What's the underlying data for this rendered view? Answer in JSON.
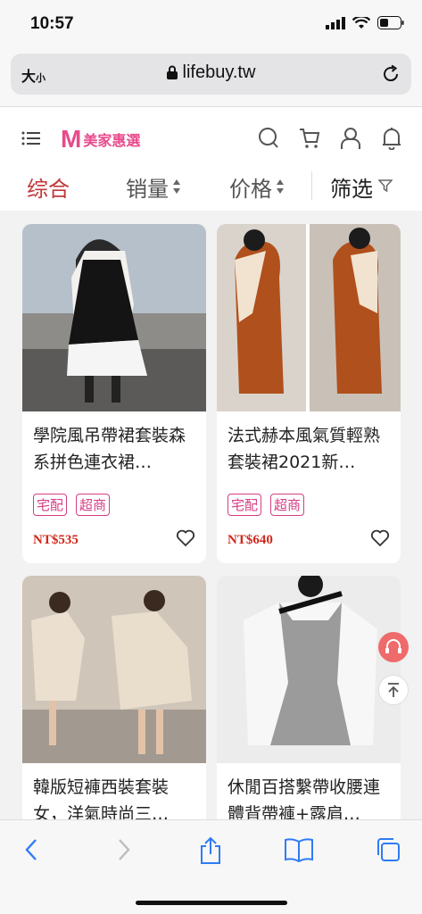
{
  "status": {
    "time": "10:57"
  },
  "browser": {
    "text_size": "大",
    "text_size_small": "小",
    "url": "lifebuy.tw"
  },
  "brand": {
    "logo_letter": "M",
    "name": "美家惠選",
    "color": "#e84a8c"
  },
  "sort": {
    "items": [
      "综合",
      "销量",
      "价格"
    ],
    "filter": "筛选",
    "active_color": "#c0373a"
  },
  "products": [
    {
      "title": "學院風吊帶裙套裝森系拼色連衣裙…",
      "tags": [
        "宅配",
        "超商"
      ],
      "price": "NT$535"
    },
    {
      "title": "法式赫本風氣質輕熟套裝裙2021新…",
      "tags": [
        "宅配",
        "超商"
      ],
      "price": "NT$640"
    },
    {
      "title": "韓版短褲西裝套裝女，洋氣時尚三…",
      "tags": [],
      "price": ""
    },
    {
      "title": "休閒百搭繫帶收腰連體背帶褲+露肩…",
      "tags": [],
      "price": ""
    }
  ],
  "icons": [
    "menu-icon",
    "search-icon",
    "cart-icon",
    "user-icon",
    "bell-icon",
    "filter-icon",
    "heart-icon",
    "support-icon",
    "back-to-top-icon",
    "back-icon",
    "forward-icon",
    "share-icon",
    "bookmarks-icon",
    "tabs-icon"
  ]
}
